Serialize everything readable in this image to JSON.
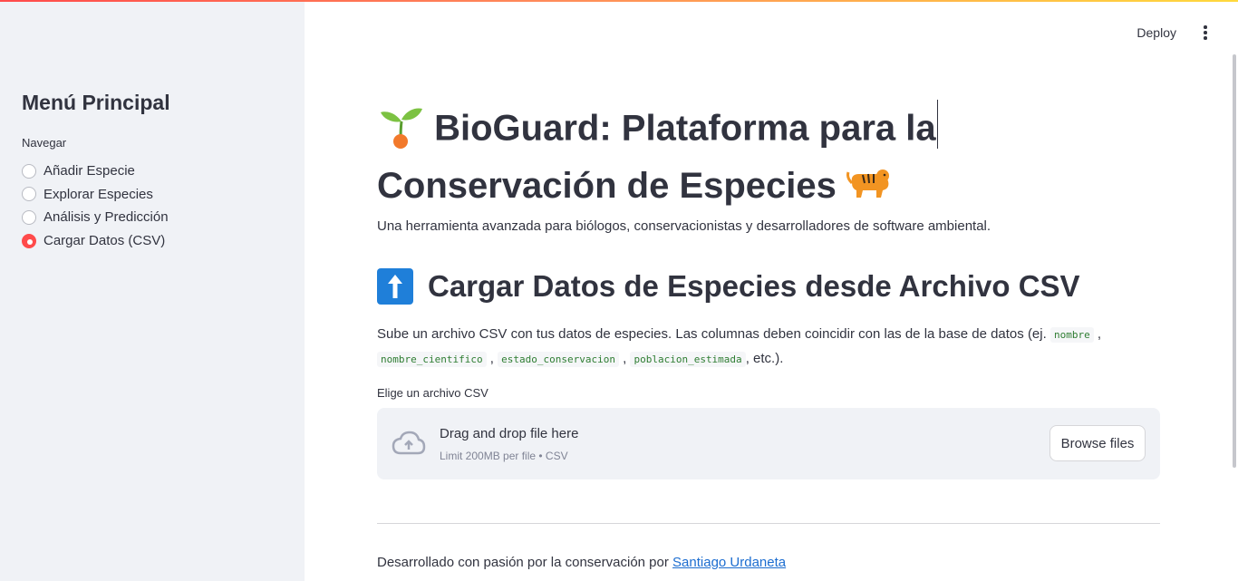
{
  "sidebar": {
    "title": "Menú Principal",
    "nav_label": "Navegar",
    "options": [
      {
        "label": "Añadir Especie",
        "selected": false
      },
      {
        "label": "Explorar Especies",
        "selected": false
      },
      {
        "label": "Análisis y Predicción",
        "selected": false
      },
      {
        "label": "Cargar Datos (CSV)",
        "selected": true
      }
    ]
  },
  "header": {
    "deploy_label": "Deploy"
  },
  "main": {
    "title_line1": "BioGuard: Plataforma para la",
    "title_line2": "Conservación de Especies",
    "subtitle": "Una herramienta avanzada para biólogos, conservacionistas y desarrolladores de software ambiental.",
    "section_title": "Cargar Datos de Especies desde Archivo CSV",
    "instructions_prefix": "Sube un archivo CSV con tus datos de especies. Las columnas deben coincidir con las de la base de datos (ej.",
    "columns": [
      "nombre",
      "nombre_cientifico",
      "estado_conservacion",
      "poblacion_estimada"
    ],
    "instructions_suffix": ", etc.).",
    "uploader": {
      "label": "Elige un archivo CSV",
      "drop_title": "Drag and drop file here",
      "limit": "Limit 200MB per file • CSV",
      "browse_label": "Browse files"
    },
    "footer_text": "Desarrollado con pasión por la conservación por",
    "footer_link": "Santiago Urdaneta"
  },
  "colors": {
    "accent": "#ff4b4b",
    "sidebar_bg": "#f0f2f6",
    "text": "#31333F",
    "link": "#1c6dd0",
    "code": "#2e7d32"
  },
  "icons": {
    "title_left": "seedling-icon",
    "title_right": "tiger-icon",
    "section": "up-arrow-icon",
    "uploader": "cloud-upload-icon",
    "menu": "kebab-menu-icon"
  }
}
